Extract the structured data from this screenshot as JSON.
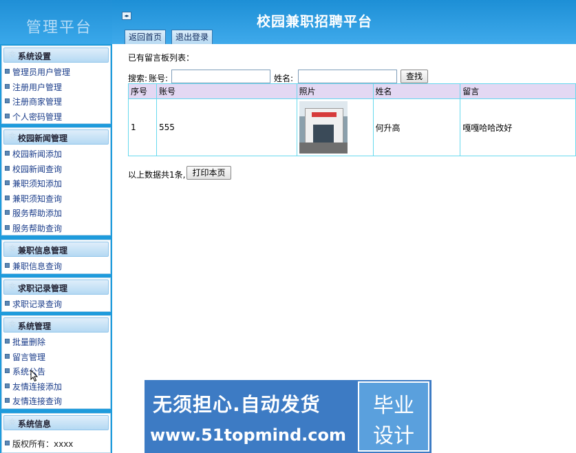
{
  "brand": {
    "title": "管理平台"
  },
  "header": {
    "site_title": "校园兼职招聘平台",
    "toggle_label": "◂▸",
    "tabs": [
      {
        "label": "返回首页"
      },
      {
        "label": "退出登录"
      }
    ]
  },
  "sidebar": {
    "groups": [
      {
        "title": "系统设置",
        "items": [
          "管理员用户管理",
          "注册用户管理",
          "注册商家管理",
          "个人密码管理"
        ]
      },
      {
        "title": "校园新闻管理",
        "items": [
          "校园新闻添加",
          "校园新闻查询",
          "兼职须知添加",
          "兼职须知查询",
          "服务帮助添加",
          "服务帮助查询"
        ]
      },
      {
        "title": "兼职信息管理",
        "items": [
          "兼职信息查询"
        ]
      },
      {
        "title": "求职记录管理",
        "items": [
          "求职记录查询"
        ]
      },
      {
        "title": "系统管理",
        "items": [
          "批量删除",
          "留言管理",
          "系统公告",
          "友情连接添加",
          "友情连接查询"
        ]
      },
      {
        "title": "系统信息",
        "items": [
          "版权所有：xxxx"
        ]
      }
    ]
  },
  "main": {
    "heading": "已有留言板列表：",
    "search": {
      "prefix_label": "搜索:",
      "account_label": "账号:",
      "account_value": "",
      "name_label": "姓名:",
      "name_value": "",
      "button_label": "查找"
    },
    "table": {
      "columns": [
        "序号",
        "账号",
        "照片",
        "姓名",
        "留言"
      ],
      "rows": [
        {
          "index": "1",
          "account": "555",
          "photo": "bank-building-photo",
          "name": "何升高",
          "message": "嘎嘎哈哈改好"
        }
      ]
    },
    "footer": {
      "count_text": "以上数据共1条,",
      "print_label": "打印本页"
    }
  },
  "watermark": {
    "line1": "无须担心.自动发货",
    "line2": "www.51topmind.com",
    "badge_line1": "毕业",
    "badge_line2": "设计"
  },
  "colors": {
    "sidebar_bg": "#1e9bdc",
    "header_bg": "#3faaeb",
    "table_border": "#66d9ee",
    "table_header_bg": "#e3d8f3",
    "banner_bg": "#3d7bc4"
  }
}
